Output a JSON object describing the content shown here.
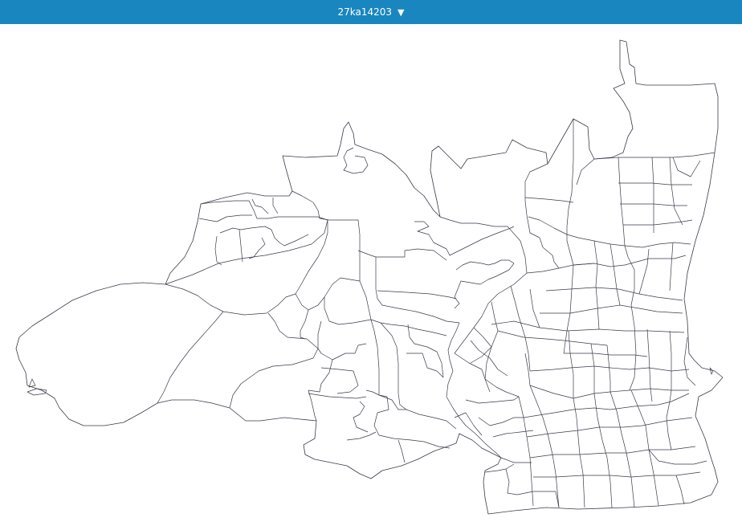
{
  "header": {
    "area_code": "27ka14203",
    "caret_icon": "triangle-down-icon",
    "bg_color": "#1a86bf",
    "text_color": "#ffffff"
  },
  "map": {
    "fill": "#ffffff",
    "stroke": "#3a3a4a"
  }
}
